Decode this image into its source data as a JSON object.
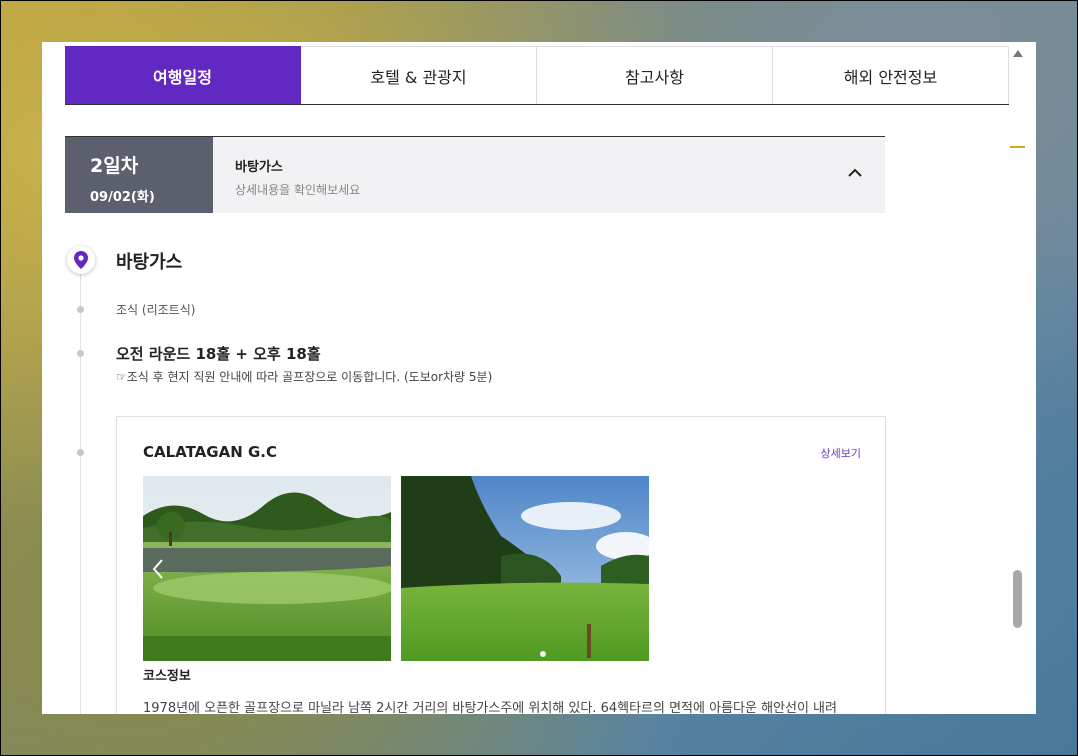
{
  "tabs": [
    {
      "label": "여행일정",
      "active": true
    },
    {
      "label": "호텔 & 관광지",
      "active": false
    },
    {
      "label": "참고사항",
      "active": false
    },
    {
      "label": "해외 안전정보",
      "active": false
    }
  ],
  "day": {
    "number": "2일차",
    "date": "09/02(화)",
    "city": "바탕가스",
    "hint": "상세내용을 확인해보세요"
  },
  "timeline": {
    "city_title": "바탕가스",
    "meal": "조식 (리조트식)",
    "round_title": "오전 라운드 18홀 + 오후 18홀",
    "round_note": "☞조식 후 현지 직원 안내에 따라 골프장으로 이동합니다. (도보or차량 5분)"
  },
  "course": {
    "name": "CALATAGAN G.C",
    "detail_link": "상세보기",
    "info_title": "코스정보",
    "info_text": "1978년에 오픈한 골프장으로 마닐라 남쪽 2시간 거리의 바탕가스주에 위치해 있다. 64헥타르의 면적에 아름다운 해안선이 내려"
  },
  "colors": {
    "accent": "#6228c2",
    "day_badge": "#5c5f6e",
    "link": "#6a3bbf"
  },
  "icons": {
    "pin": "location-pin-icon",
    "collapse": "chevron-up-icon",
    "prev": "chevron-left-icon"
  }
}
